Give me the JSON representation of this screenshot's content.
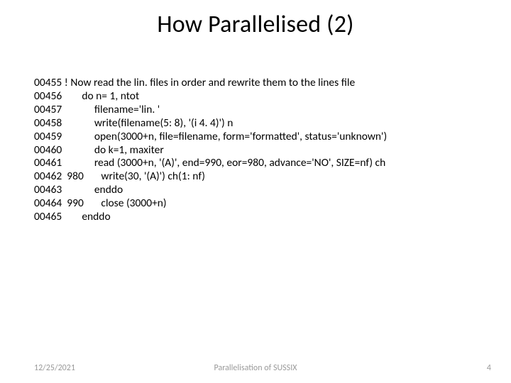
{
  "title": "How Parallelised (2)",
  "code_lines": [
    "00455 ! Now read the lin. files in order and rewrite them to the lines file",
    "00456        do n= 1, ntot",
    "00457             filename='lin. '",
    "00458             write(filename(5: 8), '(i 4. 4)') n",
    "00459             open(3000+n, file=filename, form='formatted', status='unknown')",
    "00460             do k=1, maxiter",
    "00461             read (3000+n, '(A)', end=990, eor=980, advance='NO', SIZE=nf) ch",
    "00462  980       write(30, '(A)') ch(1: nf)",
    "00463             enddo",
    "00464  990       close (3000+n)",
    "00465        enddo"
  ],
  "footer": {
    "date": "12/25/2021",
    "center": "Parallelisation of SUSSIX",
    "page": "4"
  }
}
